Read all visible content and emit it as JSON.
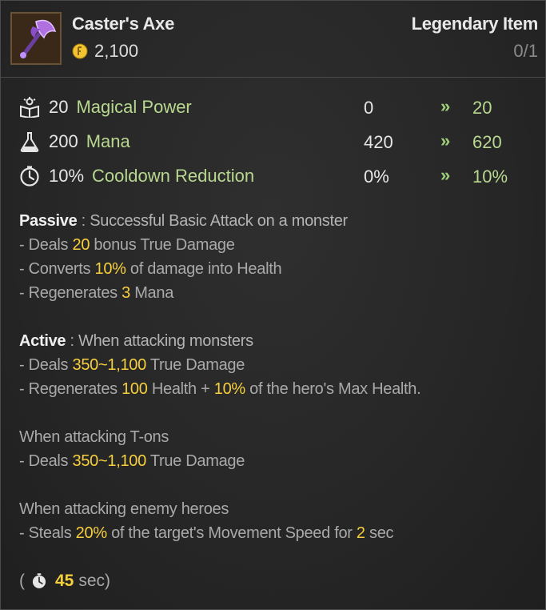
{
  "item": {
    "name": "Caster's Axe",
    "price": "2,100",
    "grade": "Legendary Item",
    "owned": "0/1",
    "icon": "purple-axe-icon",
    "coin_icon": "gold-coin-icon"
  },
  "stats": [
    {
      "amount": "20",
      "name": "Magical Power",
      "current": "0",
      "arrow": "»",
      "new": "20",
      "icon": "book-magic-icon"
    },
    {
      "amount": "200",
      "name": "Mana",
      "current": "420",
      "arrow": "»",
      "new": "620",
      "icon": "flask-icon"
    },
    {
      "amount": "10%",
      "name": "Cooldown Reduction",
      "current": "0%",
      "arrow": "»",
      "new": "10%",
      "icon": "stopwatch-icon"
    }
  ],
  "passive": {
    "label": "Passive",
    "sep": " : ",
    "text": "Successful Basic Attack on a monster",
    "lines": [
      {
        "pre": "- Deals ",
        "hl": "20",
        "post": " bonus True Damage"
      },
      {
        "pre": "- Converts ",
        "hl": "10%",
        "post": " of damage into Health"
      },
      {
        "pre": "- Regenerates ",
        "hl": "3",
        "post": " Mana"
      }
    ]
  },
  "active": {
    "label": "Active",
    "sep": " : ",
    "text": "When attacking monsters",
    "line1": {
      "pre": "- Deals ",
      "hl": "350~1,100",
      "post": " True Damage"
    },
    "line2": {
      "pre": "- Regenerates ",
      "hl1": "100",
      "mid": " Health + ",
      "hl2": "10%",
      "post": " of the hero's Max Health."
    }
  },
  "tons": {
    "heading": "When attacking T-ons",
    "line": {
      "pre": "- Deals ",
      "hl": "350~1,100",
      "post": " True Damage"
    }
  },
  "heroes": {
    "heading": "When attacking enemy heroes",
    "line": {
      "pre": "- Steals ",
      "hl1": "20%",
      "mid": " of the target's Movement Speed for ",
      "hl2": "2",
      "post": " sec"
    }
  },
  "cooldown": {
    "open": "(",
    "value": "45",
    "unit": "sec)",
    "icon": "stopwatch-icon"
  },
  "colors": {
    "highlight": "#f6cf3c",
    "stat_name": "#b8d890",
    "arrow": "#9fcf7a"
  }
}
